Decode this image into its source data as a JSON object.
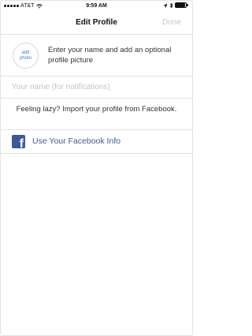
{
  "status_bar": {
    "carrier": "AT&T",
    "time": "9:59 AM"
  },
  "nav": {
    "title": "Edit Profile",
    "done_label": "Done"
  },
  "profile": {
    "add_photo_line1": "add",
    "add_photo_line2": "photo",
    "prompt": "Enter your name and add an optional profile picture"
  },
  "name_field": {
    "value": "",
    "placeholder": "Your name (for notifications)"
  },
  "import": {
    "prompt": "Feeling lazy? Import your profile from Facebook.",
    "facebook_button_label": "Use Your Facebook Info"
  },
  "colors": {
    "facebook_blue": "#3b5998",
    "link_blue": "#3f7ed6",
    "disabled_gray": "#c7c7cc"
  }
}
